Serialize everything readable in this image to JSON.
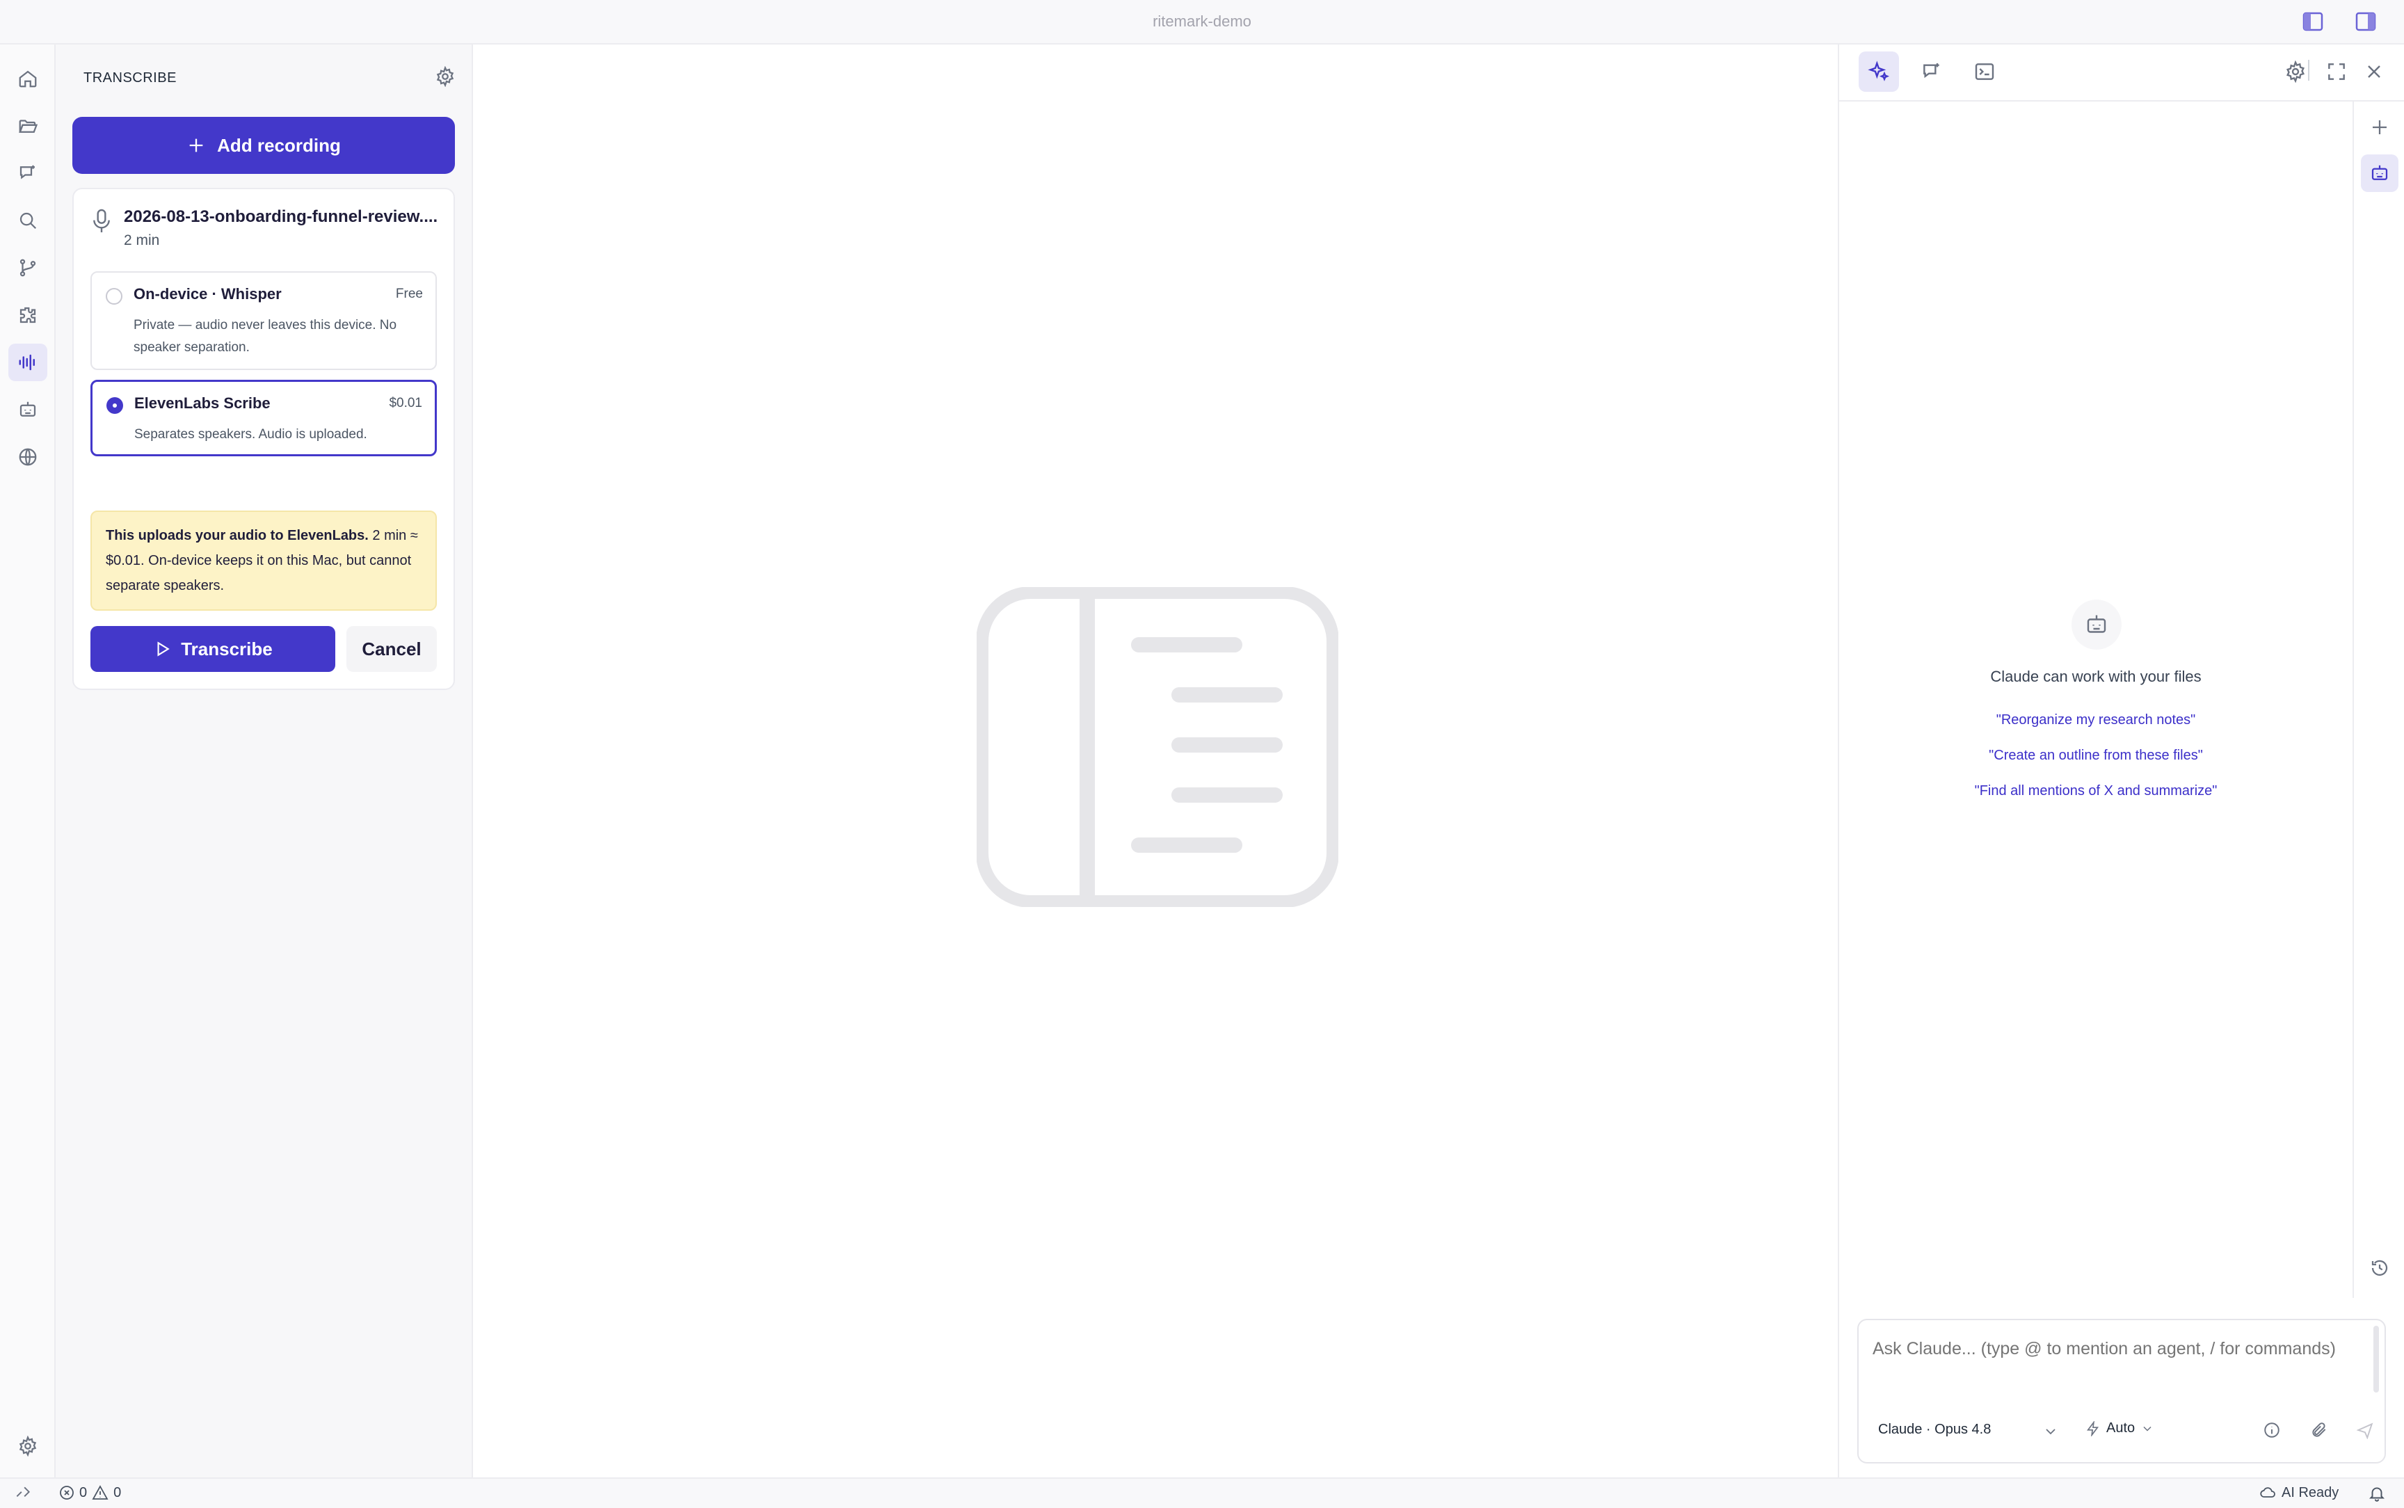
{
  "window": {
    "title": "ritemark-demo"
  },
  "activity_bar": {
    "items": [
      {
        "name": "home-icon"
      },
      {
        "name": "folder-icon"
      },
      {
        "name": "chat-icon"
      },
      {
        "name": "search-icon"
      },
      {
        "name": "git-branch-icon"
      },
      {
        "name": "extensions-icon"
      },
      {
        "name": "audio-waveform-icon",
        "active": true
      },
      {
        "name": "bot-icon"
      },
      {
        "name": "globe-icon"
      }
    ],
    "settings": "gear-icon"
  },
  "sidebar": {
    "header": "TRANSCRIBE",
    "add_recording_label": "Add recording",
    "recording": {
      "filename": "2026-08-13-onboarding-funnel-review....",
      "duration": "2 min"
    },
    "options": [
      {
        "title": "On-device · Whisper",
        "price": "Free",
        "description": "Private — audio never leaves this device. No speaker separation.",
        "selected": false
      },
      {
        "title": "ElevenLabs Scribe",
        "price": "$0.01",
        "description": "Separates speakers. Audio is uploaded.",
        "selected": true
      }
    ],
    "warning": {
      "strong": "This uploads your audio to ElevenLabs.",
      "rest": " 2 min ≈ $0.01. On-device keeps it on this Mac, but cannot separate speakers."
    },
    "transcribe_label": "Transcribe",
    "cancel_label": "Cancel"
  },
  "assistant": {
    "empty_title": "Claude can work with your files",
    "suggestions": [
      "\"Reorganize my research notes\"",
      "\"Create an outline from these files\"",
      "\"Find all mentions of X and summarize\""
    ],
    "input_placeholder": "Ask Claude... (type @ to mention an agent, / for commands)",
    "model": "Claude · Opus 4.8",
    "mode": "Auto"
  },
  "statusbar": {
    "errors": "0",
    "warnings": "0",
    "ai_status": "AI Ready"
  },
  "colors": {
    "accent": "#4338ca",
    "warning_bg": "#fdf3c7",
    "suggestion": "#3b2fc9"
  }
}
